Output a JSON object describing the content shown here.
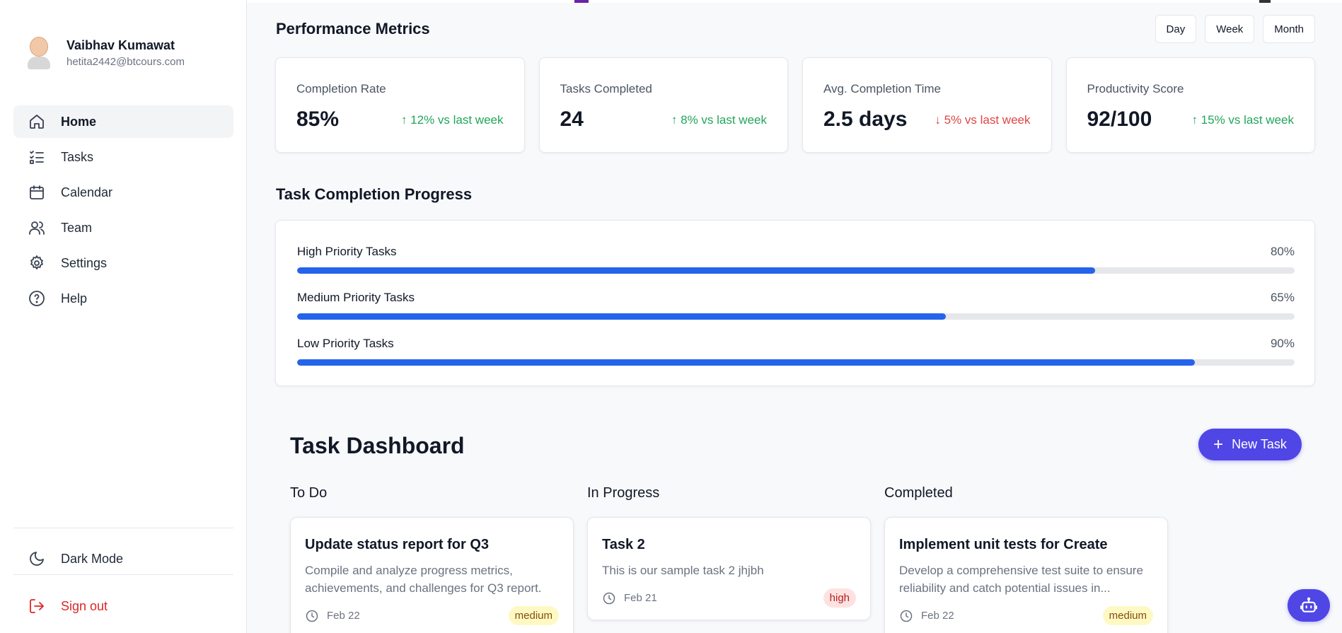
{
  "user": {
    "name": "Vaibhav Kumawat",
    "email": "hetita2442@btcours.com",
    "avatar_icon": "avatar-icon"
  },
  "sidebar": {
    "items": [
      {
        "label": "Home",
        "icon": "home-icon",
        "active": true
      },
      {
        "label": "Tasks",
        "icon": "task-list-icon",
        "active": false
      },
      {
        "label": "Calendar",
        "icon": "calendar-icon",
        "active": false
      },
      {
        "label": "Team",
        "icon": "team-icon",
        "active": false
      },
      {
        "label": "Settings",
        "icon": "gear-icon",
        "active": false
      },
      {
        "label": "Help",
        "icon": "help-icon",
        "active": false
      }
    ],
    "dark_mode_label": "Dark Mode",
    "sign_out_label": "Sign out"
  },
  "performance": {
    "title": "Performance Metrics",
    "ranges": [
      "Day",
      "Week",
      "Month"
    ],
    "metrics": [
      {
        "label": "Completion Rate",
        "value": "85%",
        "change": "↑ 12% vs last week",
        "trend": "up"
      },
      {
        "label": "Tasks Completed",
        "value": "24",
        "change": "↑ 8% vs last week",
        "trend": "up"
      },
      {
        "label": "Avg. Completion Time",
        "value": "2.5 days",
        "change": "↓ 5% vs last week",
        "trend": "down"
      },
      {
        "label": "Productivity Score",
        "value": "92/100",
        "change": "↑ 15% vs last week",
        "trend": "up"
      }
    ]
  },
  "progress": {
    "title": "Task Completion Progress",
    "rows": [
      {
        "label": "High Priority Tasks",
        "value_text": "80%",
        "value": 80
      },
      {
        "label": "Medium Priority Tasks",
        "value_text": "65%",
        "value": 65
      },
      {
        "label": "Low Priority Tasks",
        "value_text": "90%",
        "value": 90
      }
    ]
  },
  "dashboard": {
    "title": "Task Dashboard",
    "new_task_label": "New Task",
    "columns": [
      {
        "title": "To Do",
        "tasks": [
          {
            "title": "Update status report for Q3",
            "description": "Compile and analyze progress metrics, achievements, and challenges for Q3 report.",
            "date": "Feb 22",
            "priority": "medium"
          }
        ]
      },
      {
        "title": "In Progress",
        "tasks": [
          {
            "title": "Task 2",
            "description": "This is our sample task 2 jhjbh",
            "date": "Feb 21",
            "priority": "high"
          }
        ]
      },
      {
        "title": "Completed",
        "tasks": [
          {
            "title": "Implement unit tests for Create",
            "description": "Develop a comprehensive test suite to ensure reliability and catch potential issues in...",
            "date": "Feb 22",
            "priority": "medium"
          }
        ]
      }
    ]
  },
  "colors": {
    "accent": "#4f46e5",
    "progress_fill": "#2563eb",
    "positive": "#22a55a",
    "negative": "#e04545",
    "sign_out": "#dc2626"
  },
  "assistant_button_icon": "robot-icon"
}
